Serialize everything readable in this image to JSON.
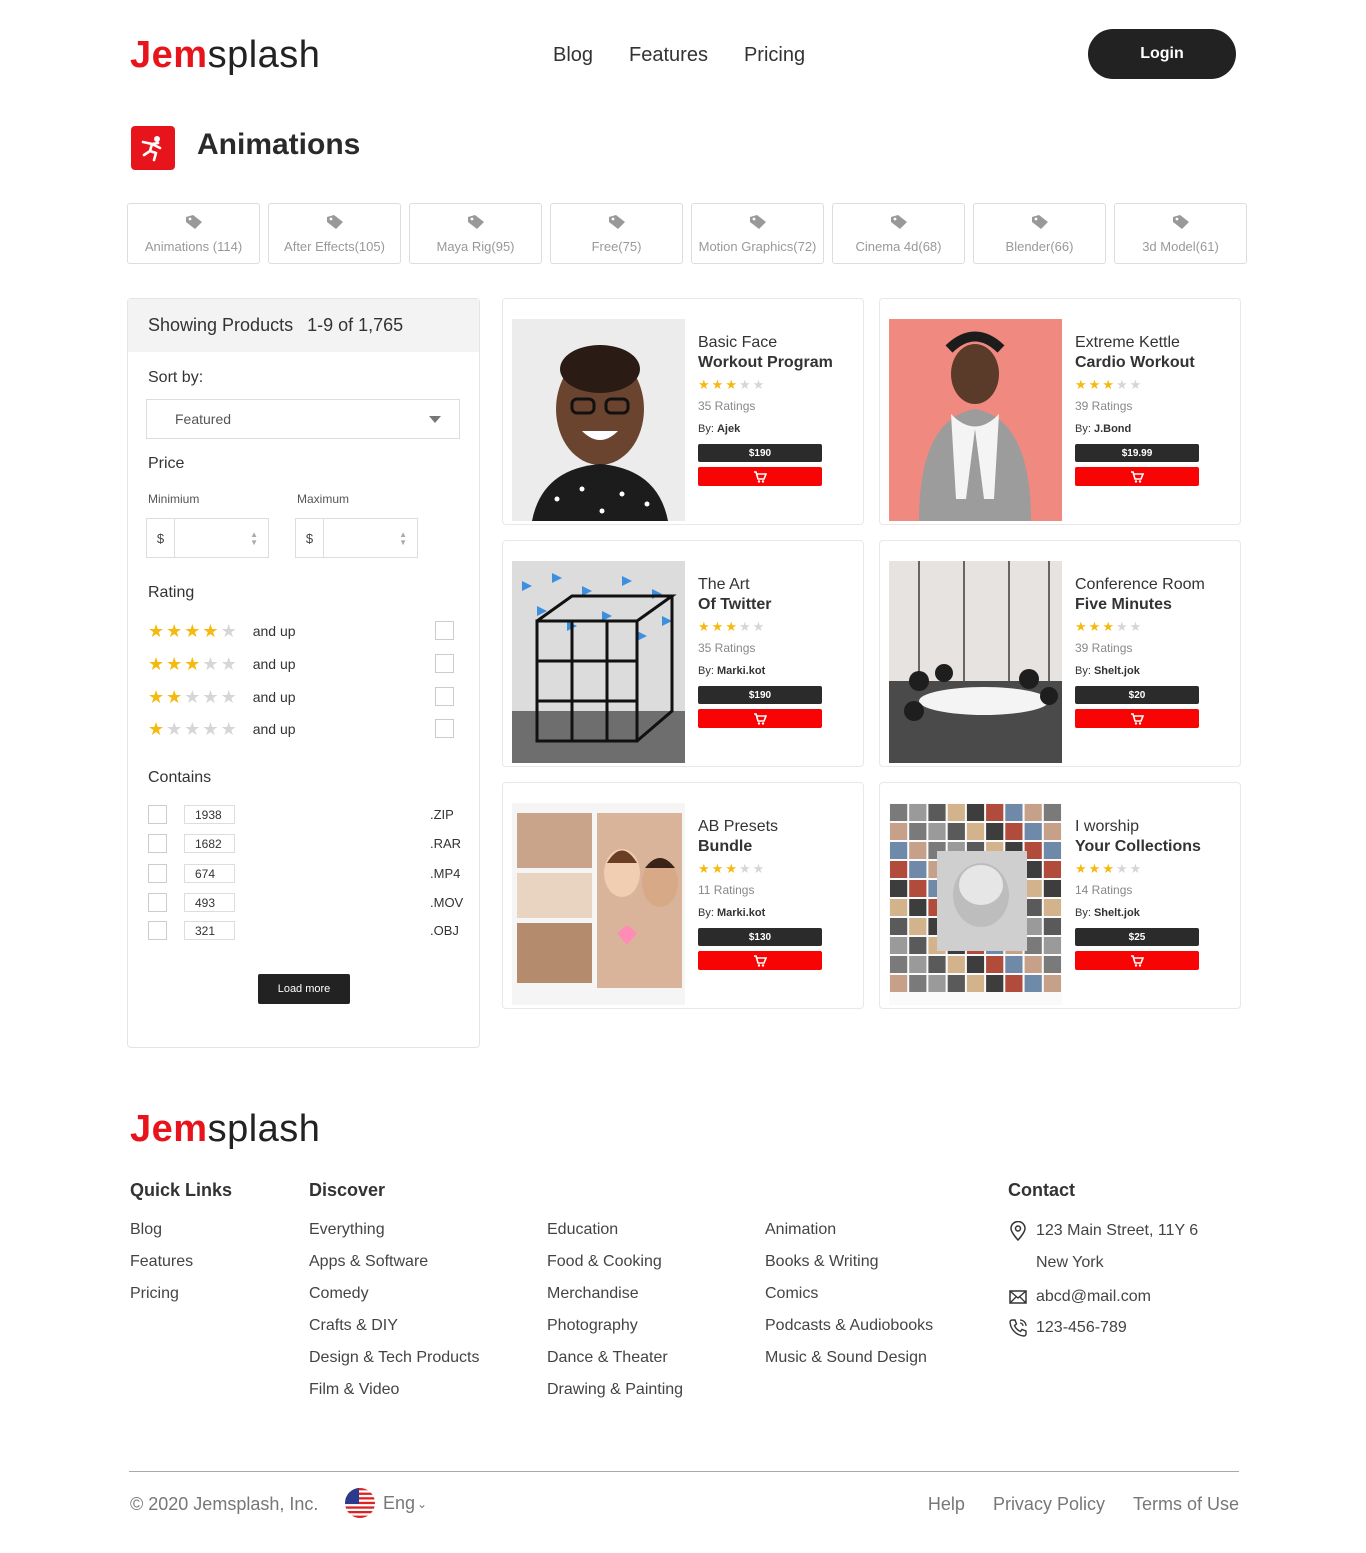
{
  "brand": {
    "part1": "Jem",
    "part2": "splash",
    "accent": "#e8141b"
  },
  "nav": [
    "Blog",
    "Features",
    "Pricing"
  ],
  "login_label": "Login",
  "page_title": "Animations",
  "tags": [
    "Animations (114)",
    "After Effects(105)",
    "Maya Rig(95)",
    "Free(75)",
    "Motion Graphics(72)",
    "Cinema 4d(68)",
    "Blender(66)",
    "3d Model(61)"
  ],
  "sidebar": {
    "showing_label": "Showing Products",
    "showing_range": "1-9 of 1,765",
    "sort_label": "Sort by:",
    "sort_value": "Featured",
    "price_label": "Price",
    "min_label": "Minimium",
    "max_label": "Maximum",
    "currency": "$",
    "rating_label": "Rating",
    "ratings": [
      {
        "stars": 4,
        "text": "and up"
      },
      {
        "stars": 3,
        "text": "and up"
      },
      {
        "stars": 2,
        "text": "and up"
      },
      {
        "stars": 1,
        "text": "and up"
      }
    ],
    "contains_label": "Contains",
    "contains": [
      {
        "count": "1938",
        "ext": ".ZIP"
      },
      {
        "count": "1682",
        "ext": ".RAR"
      },
      {
        "count": "674",
        "ext": ".MP4"
      },
      {
        "count": "493",
        "ext": ".MOV"
      },
      {
        "count": "321",
        "ext": ".OBJ"
      }
    ],
    "load_more": "Load more"
  },
  "products": [
    {
      "t1": "Basic Face",
      "t2": "Workout Program",
      "stars": 3,
      "ratings": "35 Ratings",
      "by": "By:",
      "author": "Ajek",
      "price": "$190"
    },
    {
      "t1": "Extreme Kettle",
      "t2": "Cardio Workout",
      "stars": 3,
      "ratings": "39 Ratings",
      "by": "By:",
      "author": "J.Bond",
      "price": "$19.99"
    },
    {
      "t1": "The Art",
      "t2": "Of Twitter",
      "stars": 3,
      "ratings": "35 Ratings",
      "by": "By:",
      "author": "Marki.kot",
      "price": "$190"
    },
    {
      "t1": "Conference Room",
      "t2": "Five Minutes",
      "stars": 3,
      "ratings": "39 Ratings",
      "by": "By:",
      "author": "Shelt.jok",
      "price": "$20"
    },
    {
      "t1": "AB Presets",
      "t2": "Bundle",
      "stars": 3,
      "ratings": "11 Ratings",
      "by": "By:",
      "author": "Marki.kot",
      "price": "$130"
    },
    {
      "t1": "I worship",
      "t2": "Your Collections",
      "stars": 3,
      "ratings": "14 Ratings",
      "by": "By:",
      "author": "Shelt.jok",
      "price": "$25"
    }
  ],
  "footer": {
    "quick_links_title": "Quick Links",
    "quick_links": [
      "Blog",
      "Features",
      "Pricing"
    ],
    "discover_title": "Discover",
    "discover_col1": [
      "Everything",
      "Apps & Software",
      "Comedy",
      "Crafts & DIY",
      "Design & Tech Products",
      "Film & Video"
    ],
    "discover_col2": [
      "Education",
      "Food & Cooking",
      "Merchandise",
      "Photography",
      "Dance & Theater",
      "Drawing & Painting"
    ],
    "discover_col3": [
      "Animation",
      "Books & Writing",
      "Comics",
      "Podcasts & Audiobooks",
      "Music & Sound Design"
    ],
    "contact_title": "Contact",
    "address1": "123 Main Street, 11Y 6",
    "address2": "New York",
    "email": "abcd@mail.com",
    "phone": "123-456-789",
    "copyright": "© 2020 Jemsplash, Inc.",
    "language": "Eng",
    "legal": [
      "Help",
      "Privacy Policy",
      "Terms of Use"
    ]
  }
}
